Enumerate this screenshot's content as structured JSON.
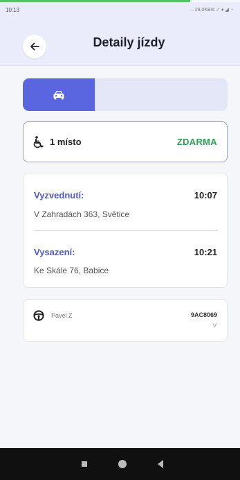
{
  "status_bar": {
    "time": "10:13",
    "indicators": "...29,0KB/s ✓ ♦ ◢ ◔"
  },
  "header": {
    "title": "Detaily jízdy",
    "back_icon": "arrow-left-icon"
  },
  "ride_type": {
    "active_icon": "car-icon"
  },
  "seat": {
    "icon": "wheelchair-icon",
    "label": "1 místo",
    "price": "ZDARMA"
  },
  "route": {
    "pickup": {
      "label": "Vyzvednutí:",
      "time": "10:07",
      "address": "V Zahradách 363, Světice"
    },
    "dropoff": {
      "label": "Vysazení:",
      "time": "10:21",
      "address": "Ke Skále 76, Babice"
    }
  },
  "driver": {
    "icon": "steering-wheel-icon",
    "name": "Pavel Z",
    "plate": "9AC8069",
    "plate_suffix": "V"
  },
  "colors": {
    "accent": "#5a66e0",
    "free": "#2e9e54",
    "label": "#4f58c8"
  }
}
